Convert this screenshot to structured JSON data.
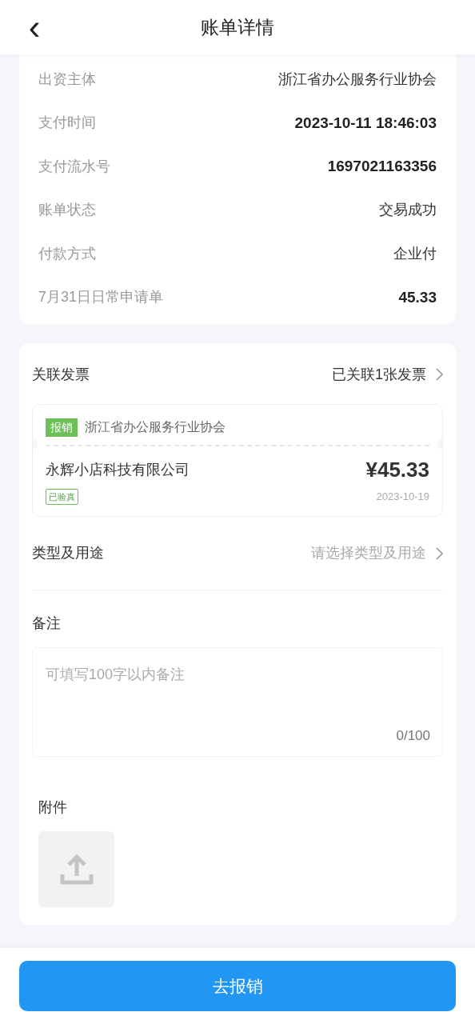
{
  "header": {
    "back_icon": "‹",
    "title": "账单详情"
  },
  "details": [
    {
      "label": "出资主体",
      "value": "浙江省办公服务行业协会",
      "bold": false
    },
    {
      "label": "支付时间",
      "value": "2023-10-11 18:46:03",
      "bold": true
    },
    {
      "label": "支付流水号",
      "value": "1697021163356",
      "bold": true
    },
    {
      "label": "账单状态",
      "value": "交易成功",
      "bold": false
    },
    {
      "label": "付款方式",
      "value": "企业付",
      "bold": false
    },
    {
      "label": "7月31日日常申请单",
      "value": "45.33",
      "bold": true
    }
  ],
  "invoices": {
    "label": "关联发票",
    "summary": "已关联1张发票",
    "items": [
      {
        "tag": "报销",
        "payer": "浙江省办公服务行业协会",
        "seller": "永辉小店科技有限公司",
        "amount": "¥45.33",
        "verified_badge": "已验真",
        "date": "2023-10-19"
      }
    ]
  },
  "purpose": {
    "label": "类型及用途",
    "placeholder": "请选择类型及用途"
  },
  "remark": {
    "label": "备注",
    "placeholder": "可填写100字以内备注",
    "counter": "0/100"
  },
  "attachment": {
    "label": "附件"
  },
  "submit_button": "去报销"
}
